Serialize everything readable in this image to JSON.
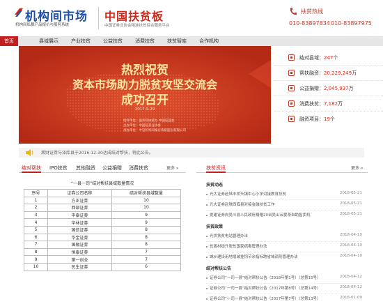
{
  "header": {
    "logo_text": "机构间市场",
    "logo_sub": "机构间私募产品报价与服务系统",
    "logo2_text": "中国扶贫板",
    "logo2_sub": "中国证券业协会精准扶贫综合服务平台",
    "hotline_label": "扶贫热线",
    "hotline_nums": [
      "010-83897834",
      "010-83897975"
    ]
  },
  "nav": {
    "items": [
      "首页",
      "县域展示",
      "产业扶贫",
      "公益扶贫",
      "消费扶贫",
      "扶贫智库",
      "合作机构"
    ]
  },
  "banner": {
    "line1": "热烈祝贺",
    "line2": "资本市场助力脱贫攻坚交流会",
    "line3": "成功召开",
    "date": "2017-9-29",
    "fine": [
      "指导单位：国务院扶贫办    中国证监会",
      "主办单位：中国证券业协会",
      "承办单位：中证机构间报价系统股份有限公司"
    ]
  },
  "stats": {
    "rows": [
      {
        "label": "结对县域：",
        "value": "247",
        "unit": "个"
      },
      {
        "label": "帮扶融资：",
        "value": "20,229,249",
        "unit": "万"
      },
      {
        "label": "公益捐赠：",
        "value": "2,045,937",
        "unit": "万"
      },
      {
        "label": "消费扶贫：",
        "value": "7,182",
        "unit": "万"
      },
      {
        "label": "融资项目：",
        "value": "19",
        "unit": "个"
      }
    ]
  },
  "ticker": {
    "text": "湘财证券与泽库县于2016-12-30达成结对帮扶，特此公告。"
  },
  "left": {
    "tabs": [
      "结对帮扶",
      "IPO扶贫",
      "其他融资",
      "公益捐赠",
      "消费扶贫"
    ],
    "more": "更多 »",
    "table_title": "“一县一司”结对帮扶县域数量情况",
    "headers": [
      "序号",
      "证券公司名称",
      "结对帮扶县域数量"
    ],
    "rows": [
      [
        "1",
        "方正证券",
        "10"
      ],
      [
        "2",
        "西部证券",
        "10"
      ],
      [
        "3",
        "中泰证券",
        "9"
      ],
      [
        "4",
        "华林证券",
        "9"
      ],
      [
        "5",
        "国信证券",
        "8"
      ],
      [
        "6",
        "华金证券",
        "8"
      ],
      [
        "7",
        "国融证券",
        "8"
      ],
      [
        "8",
        "恒泰证券",
        "7"
      ],
      [
        "9",
        "第一创业",
        "7"
      ],
      [
        "10",
        "民生证券",
        "6"
      ]
    ]
  },
  "right": {
    "title": "扶贫资讯",
    "more": "更多 »",
    "sections": [
      {
        "name": "扶贫动态",
        "items": [
          {
            "text": "光大证券赴陆丰桥头镇中心小学对接教育扶贫",
            "date": "2018-05-21"
          },
          {
            "text": "光大证券赴陕西临县对接金融扶贫工作",
            "date": "2018-05-21"
          },
          {
            "text": "爱建证券向吴川县人民政府捐赠20台吴山云雾茶自助售卖机",
            "date": "2018-05-21"
          }
        ]
      },
      {
        "name": "扶贫政策",
        "items": [
          {
            "text": "光伏扶贫电站管理办法",
            "date": "2018-04-10"
          },
          {
            "text": "贫困村提升脱贫国家病毒管理办法",
            "date": "2018-04-10"
          },
          {
            "text": "城乡建设用地增减挂钩节余指标跨省域调剂管理办法",
            "date": "2018-04-10"
          }
        ]
      },
      {
        "name": "结对帮扶公告",
        "items": [
          {
            "text": "证券公司“一司一县”结对帮扶公告（2018年第1号）（总第15号）",
            "date": "2018-04-12"
          },
          {
            "text": "证券公司“一司一县”结对帮扶公告（2017年第8号）（总第14号）",
            "date": "2018-04-12"
          },
          {
            "text": "证券公司“一司一县”结对帮扶公告（2017年第7号）（总第13号）",
            "date": "2018-01-09"
          }
        ]
      }
    ]
  }
}
